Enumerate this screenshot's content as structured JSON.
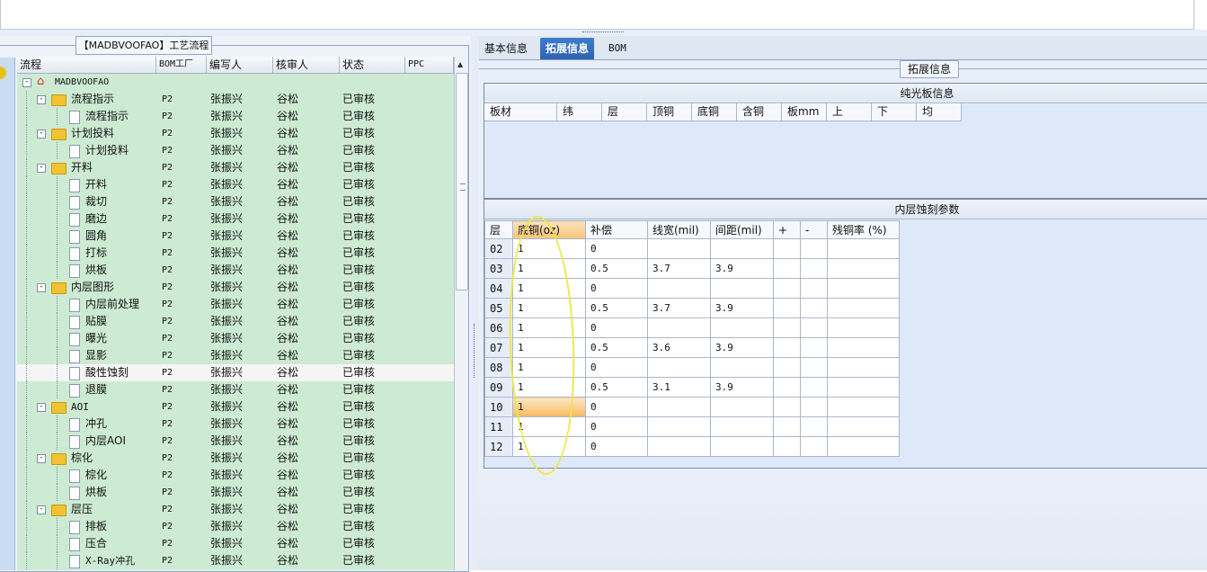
{
  "left_panel": {
    "title": "【MADBVOOFAO】工艺流程",
    "columns": [
      "流程",
      "BOM工厂",
      "编写人",
      "核审人",
      "状态",
      "PPC"
    ],
    "rows": [
      {
        "level": 0,
        "type": "root",
        "name": "MADBVOOFAO",
        "bom": "",
        "writer": "",
        "reviewer": "",
        "status": ""
      },
      {
        "level": 1,
        "type": "folder",
        "name": "流程指示",
        "bom": "P2",
        "writer": "张振兴",
        "reviewer": "谷松",
        "status": "已审核"
      },
      {
        "level": 2,
        "type": "doc",
        "name": "流程指示",
        "bom": "P2",
        "writer": "张振兴",
        "reviewer": "谷松",
        "status": "已审核"
      },
      {
        "level": 1,
        "type": "folder",
        "name": "计划投料",
        "bom": "P2",
        "writer": "张振兴",
        "reviewer": "谷松",
        "status": "已审核"
      },
      {
        "level": 2,
        "type": "doc",
        "name": "计划投料",
        "bom": "P2",
        "writer": "张振兴",
        "reviewer": "谷松",
        "status": "已审核"
      },
      {
        "level": 1,
        "type": "folder",
        "name": "开料",
        "bom": "P2",
        "writer": "张振兴",
        "reviewer": "谷松",
        "status": "已审核"
      },
      {
        "level": 2,
        "type": "doc",
        "name": "开料",
        "bom": "P2",
        "writer": "张振兴",
        "reviewer": "谷松",
        "status": "已审核"
      },
      {
        "level": 2,
        "type": "doc",
        "name": "裁切",
        "bom": "P2",
        "writer": "张振兴",
        "reviewer": "谷松",
        "status": "已审核"
      },
      {
        "level": 2,
        "type": "doc",
        "name": "磨边",
        "bom": "P2",
        "writer": "张振兴",
        "reviewer": "谷松",
        "status": "已审核"
      },
      {
        "level": 2,
        "type": "doc",
        "name": "圆角",
        "bom": "P2",
        "writer": "张振兴",
        "reviewer": "谷松",
        "status": "已审核"
      },
      {
        "level": 2,
        "type": "doc",
        "name": "打标",
        "bom": "P2",
        "writer": "张振兴",
        "reviewer": "谷松",
        "status": "已审核"
      },
      {
        "level": 2,
        "type": "doc",
        "name": "烘板",
        "bom": "P2",
        "writer": "张振兴",
        "reviewer": "谷松",
        "status": "已审核"
      },
      {
        "level": 1,
        "type": "folder",
        "name": "内层图形",
        "bom": "P2",
        "writer": "张振兴",
        "reviewer": "谷松",
        "status": "已审核"
      },
      {
        "level": 2,
        "type": "doc",
        "name": "内层前处理",
        "bom": "P2",
        "writer": "张振兴",
        "reviewer": "谷松",
        "status": "已审核"
      },
      {
        "level": 2,
        "type": "doc",
        "name": "贴膜",
        "bom": "P2",
        "writer": "张振兴",
        "reviewer": "谷松",
        "status": "已审核"
      },
      {
        "level": 2,
        "type": "doc",
        "name": "曝光",
        "bom": "P2",
        "writer": "张振兴",
        "reviewer": "谷松",
        "status": "已审核"
      },
      {
        "level": 2,
        "type": "doc",
        "name": "显影",
        "bom": "P2",
        "writer": "张振兴",
        "reviewer": "谷松",
        "status": "已审核"
      },
      {
        "level": 2,
        "type": "doc",
        "name": "酸性蚀刻",
        "bom": "P2",
        "writer": "张振兴",
        "reviewer": "谷松",
        "status": "已审核",
        "selected": true
      },
      {
        "level": 2,
        "type": "doc",
        "name": "退膜",
        "bom": "P2",
        "writer": "张振兴",
        "reviewer": "谷松",
        "status": "已审核"
      },
      {
        "level": 1,
        "type": "folder",
        "name": "AOI",
        "bom": "P2",
        "writer": "张振兴",
        "reviewer": "谷松",
        "status": "已审核"
      },
      {
        "level": 2,
        "type": "doc",
        "name": "冲孔",
        "bom": "P2",
        "writer": "张振兴",
        "reviewer": "谷松",
        "status": "已审核"
      },
      {
        "level": 2,
        "type": "doc",
        "name": "内层AOI",
        "bom": "P2",
        "writer": "张振兴",
        "reviewer": "谷松",
        "status": "已审核"
      },
      {
        "level": 1,
        "type": "folder",
        "name": "棕化",
        "bom": "P2",
        "writer": "张振兴",
        "reviewer": "谷松",
        "status": "已审核"
      },
      {
        "level": 2,
        "type": "doc",
        "name": "棕化",
        "bom": "P2",
        "writer": "张振兴",
        "reviewer": "谷松",
        "status": "已审核"
      },
      {
        "level": 2,
        "type": "doc",
        "name": "烘板",
        "bom": "P2",
        "writer": "张振兴",
        "reviewer": "谷松",
        "status": "已审核"
      },
      {
        "level": 1,
        "type": "folder",
        "name": "层压",
        "bom": "P2",
        "writer": "张振兴",
        "reviewer": "谷松",
        "status": "已审核"
      },
      {
        "level": 2,
        "type": "doc",
        "name": "排板",
        "bom": "P2",
        "writer": "张振兴",
        "reviewer": "谷松",
        "status": "已审核"
      },
      {
        "level": 2,
        "type": "doc",
        "name": "压合",
        "bom": "P2",
        "writer": "张振兴",
        "reviewer": "谷松",
        "status": "已审核"
      },
      {
        "level": 2,
        "type": "doc",
        "name": "X-Ray冲孔",
        "bom": "P2",
        "writer": "张振兴",
        "reviewer": "谷松",
        "status": "已审核"
      }
    ]
  },
  "right_panel": {
    "tabs": [
      {
        "label": "基本信息",
        "active": false
      },
      {
        "label": "拓展信息",
        "active": true
      },
      {
        "label": "BOM",
        "active": false
      }
    ],
    "group_title": "拓展信息",
    "plain_board": {
      "title": "纯光板信息",
      "columns": [
        "板材",
        "纬",
        "层",
        "顶铜",
        "底铜",
        "含铜",
        "板mm",
        "上",
        "下",
        "均"
      ]
    },
    "inner_etch": {
      "title": "内层蚀刻参数",
      "columns": [
        "层",
        "底铜(oz)",
        "补偿",
        "线宽(mil)",
        "间距(mil)",
        "+",
        "-",
        "残铜率 (%)"
      ],
      "rows": [
        {
          "layer": "02",
          "base_cu": "1",
          "comp": "0",
          "line_width": "",
          "spacing": ""
        },
        {
          "layer": "03",
          "base_cu": "1",
          "comp": "0.5",
          "line_width": "3.7",
          "spacing": "3.9"
        },
        {
          "layer": "04",
          "base_cu": "1",
          "comp": "0",
          "line_width": "",
          "spacing": ""
        },
        {
          "layer": "05",
          "base_cu": "1",
          "comp": "0.5",
          "line_width": "3.7",
          "spacing": "3.9"
        },
        {
          "layer": "06",
          "base_cu": "1",
          "comp": "0",
          "line_width": "",
          "spacing": ""
        },
        {
          "layer": "07",
          "base_cu": "1",
          "comp": "0.5",
          "line_width": "3.6",
          "spacing": "3.9"
        },
        {
          "layer": "08",
          "base_cu": "1",
          "comp": "0",
          "line_width": "",
          "spacing": ""
        },
        {
          "layer": "09",
          "base_cu": "1",
          "comp": "0.5",
          "line_width": "3.1",
          "spacing": "3.9"
        },
        {
          "layer": "10",
          "base_cu": "1",
          "comp": "0",
          "line_width": "",
          "spacing": "",
          "highlighted": true
        },
        {
          "layer": "11",
          "base_cu": "1",
          "comp": "0",
          "line_width": "",
          "spacing": ""
        },
        {
          "layer": "12",
          "base_cu": "1",
          "comp": "0",
          "line_width": "",
          "spacing": ""
        }
      ]
    }
  },
  "colors": {
    "tree_bg": "#cdebd3",
    "active_tab": "#2c63b3",
    "annotation": "#ece84a",
    "grid_bg": "#dde9f8"
  }
}
